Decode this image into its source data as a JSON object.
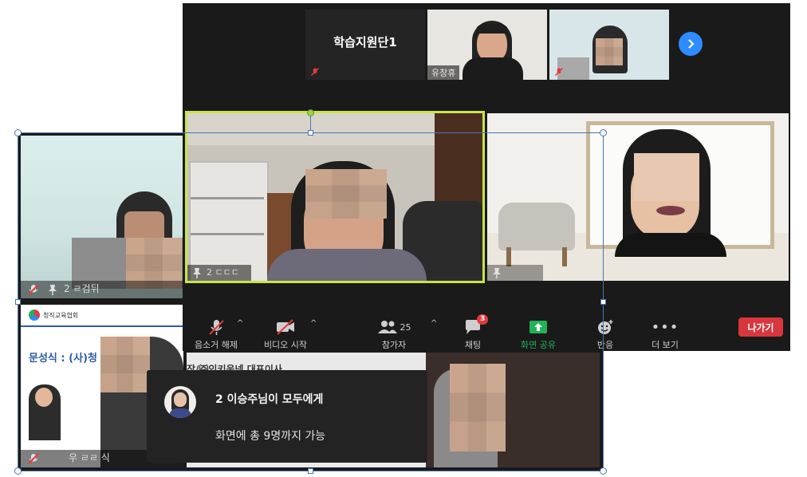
{
  "strip": {
    "name_tile_label": "학습지원단1",
    "tile2_name": "유창휴",
    "next_arrow": "chevron-right-icon"
  },
  "gallery": {
    "main_tile_name": "2 ㄷㄷㄷ",
    "right_tile_name": ""
  },
  "toolbar": {
    "unmute_label": "음소거 해제",
    "start_video_label": "비디오 시작",
    "participants_label": "참가자",
    "participants_count": "25",
    "chat_label": "채팅",
    "chat_badge": "3",
    "share_label": "화면 공유",
    "reactions_label": "반응",
    "more_label": "더 보기",
    "leave_label": "나가기"
  },
  "back_window": {
    "org_name": "청직교육협회",
    "slide_text": "문성식 : (사)청",
    "slide_text_right": "장/㈜인키움넷 대표이사",
    "tile_a_name": "2 ㄹ검뒤",
    "tile_b_name": "우 ㄹㄹ 식"
  },
  "chat": {
    "sender": "2 이승주님이 모두에게",
    "message": "화면에 총 9명까지 가능"
  },
  "colors": {
    "active_speaker_border": "#c7e54a",
    "leave_button": "#d9363e",
    "share_icon": "#23b158",
    "chat_badge": "#e5393c",
    "next_arrow_bg": "#2d8cff"
  }
}
